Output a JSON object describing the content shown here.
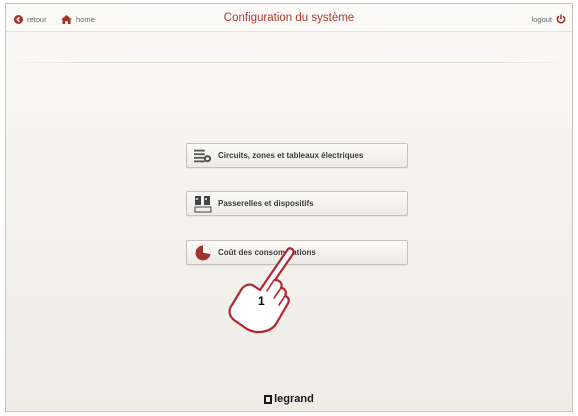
{
  "header": {
    "back_label": "retour",
    "home_label": "home",
    "title": "Configuration du système",
    "logout_label": "logout"
  },
  "menu": {
    "items": [
      {
        "label": "Circuits, zones et tableaux électriques",
        "icon": "circuits-icon"
      },
      {
        "label": "Passerelles et dispositifs",
        "icon": "devices-icon"
      },
      {
        "label": "Coût des consommations",
        "icon": "cost-pie-icon"
      }
    ]
  },
  "callout": {
    "number": "1"
  },
  "footer": {
    "brand": "legrand"
  },
  "colors": {
    "title": "#b03a2e",
    "accent_icon": "#a0362a"
  }
}
